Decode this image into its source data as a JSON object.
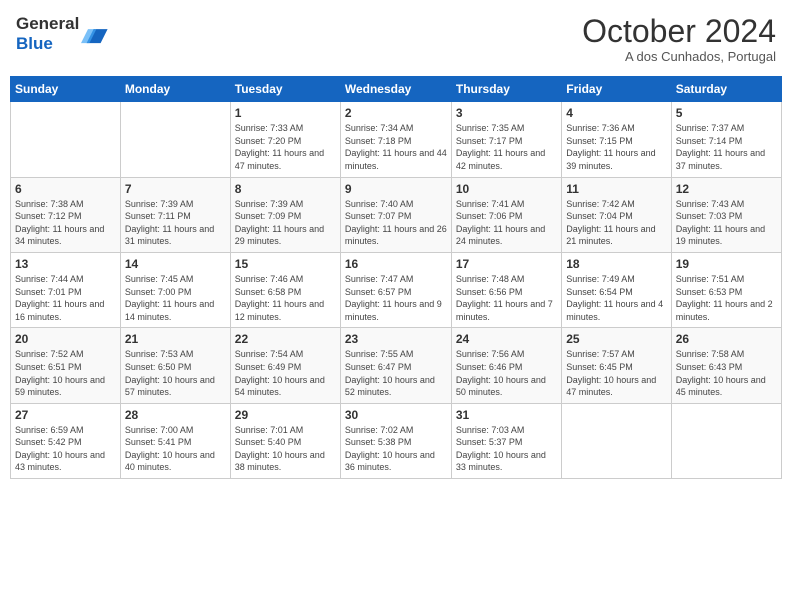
{
  "header": {
    "logo_line1": "General",
    "logo_line2": "Blue",
    "month_title": "October 2024",
    "location": "A dos Cunhados, Portugal"
  },
  "days_of_week": [
    "Sunday",
    "Monday",
    "Tuesday",
    "Wednesday",
    "Thursday",
    "Friday",
    "Saturday"
  ],
  "weeks": [
    [
      {
        "day": "",
        "info": ""
      },
      {
        "day": "",
        "info": ""
      },
      {
        "day": "1",
        "info": "Sunrise: 7:33 AM\nSunset: 7:20 PM\nDaylight: 11 hours and 47 minutes."
      },
      {
        "day": "2",
        "info": "Sunrise: 7:34 AM\nSunset: 7:18 PM\nDaylight: 11 hours and 44 minutes."
      },
      {
        "day": "3",
        "info": "Sunrise: 7:35 AM\nSunset: 7:17 PM\nDaylight: 11 hours and 42 minutes."
      },
      {
        "day": "4",
        "info": "Sunrise: 7:36 AM\nSunset: 7:15 PM\nDaylight: 11 hours and 39 minutes."
      },
      {
        "day": "5",
        "info": "Sunrise: 7:37 AM\nSunset: 7:14 PM\nDaylight: 11 hours and 37 minutes."
      }
    ],
    [
      {
        "day": "6",
        "info": "Sunrise: 7:38 AM\nSunset: 7:12 PM\nDaylight: 11 hours and 34 minutes."
      },
      {
        "day": "7",
        "info": "Sunrise: 7:39 AM\nSunset: 7:11 PM\nDaylight: 11 hours and 31 minutes."
      },
      {
        "day": "8",
        "info": "Sunrise: 7:39 AM\nSunset: 7:09 PM\nDaylight: 11 hours and 29 minutes."
      },
      {
        "day": "9",
        "info": "Sunrise: 7:40 AM\nSunset: 7:07 PM\nDaylight: 11 hours and 26 minutes."
      },
      {
        "day": "10",
        "info": "Sunrise: 7:41 AM\nSunset: 7:06 PM\nDaylight: 11 hours and 24 minutes."
      },
      {
        "day": "11",
        "info": "Sunrise: 7:42 AM\nSunset: 7:04 PM\nDaylight: 11 hours and 21 minutes."
      },
      {
        "day": "12",
        "info": "Sunrise: 7:43 AM\nSunset: 7:03 PM\nDaylight: 11 hours and 19 minutes."
      }
    ],
    [
      {
        "day": "13",
        "info": "Sunrise: 7:44 AM\nSunset: 7:01 PM\nDaylight: 11 hours and 16 minutes."
      },
      {
        "day": "14",
        "info": "Sunrise: 7:45 AM\nSunset: 7:00 PM\nDaylight: 11 hours and 14 minutes."
      },
      {
        "day": "15",
        "info": "Sunrise: 7:46 AM\nSunset: 6:58 PM\nDaylight: 11 hours and 12 minutes."
      },
      {
        "day": "16",
        "info": "Sunrise: 7:47 AM\nSunset: 6:57 PM\nDaylight: 11 hours and 9 minutes."
      },
      {
        "day": "17",
        "info": "Sunrise: 7:48 AM\nSunset: 6:56 PM\nDaylight: 11 hours and 7 minutes."
      },
      {
        "day": "18",
        "info": "Sunrise: 7:49 AM\nSunset: 6:54 PM\nDaylight: 11 hours and 4 minutes."
      },
      {
        "day": "19",
        "info": "Sunrise: 7:51 AM\nSunset: 6:53 PM\nDaylight: 11 hours and 2 minutes."
      }
    ],
    [
      {
        "day": "20",
        "info": "Sunrise: 7:52 AM\nSunset: 6:51 PM\nDaylight: 10 hours and 59 minutes."
      },
      {
        "day": "21",
        "info": "Sunrise: 7:53 AM\nSunset: 6:50 PM\nDaylight: 10 hours and 57 minutes."
      },
      {
        "day": "22",
        "info": "Sunrise: 7:54 AM\nSunset: 6:49 PM\nDaylight: 10 hours and 54 minutes."
      },
      {
        "day": "23",
        "info": "Sunrise: 7:55 AM\nSunset: 6:47 PM\nDaylight: 10 hours and 52 minutes."
      },
      {
        "day": "24",
        "info": "Sunrise: 7:56 AM\nSunset: 6:46 PM\nDaylight: 10 hours and 50 minutes."
      },
      {
        "day": "25",
        "info": "Sunrise: 7:57 AM\nSunset: 6:45 PM\nDaylight: 10 hours and 47 minutes."
      },
      {
        "day": "26",
        "info": "Sunrise: 7:58 AM\nSunset: 6:43 PM\nDaylight: 10 hours and 45 minutes."
      }
    ],
    [
      {
        "day": "27",
        "info": "Sunrise: 6:59 AM\nSunset: 5:42 PM\nDaylight: 10 hours and 43 minutes."
      },
      {
        "day": "28",
        "info": "Sunrise: 7:00 AM\nSunset: 5:41 PM\nDaylight: 10 hours and 40 minutes."
      },
      {
        "day": "29",
        "info": "Sunrise: 7:01 AM\nSunset: 5:40 PM\nDaylight: 10 hours and 38 minutes."
      },
      {
        "day": "30",
        "info": "Sunrise: 7:02 AM\nSunset: 5:38 PM\nDaylight: 10 hours and 36 minutes."
      },
      {
        "day": "31",
        "info": "Sunrise: 7:03 AM\nSunset: 5:37 PM\nDaylight: 10 hours and 33 minutes."
      },
      {
        "day": "",
        "info": ""
      },
      {
        "day": "",
        "info": ""
      }
    ]
  ]
}
